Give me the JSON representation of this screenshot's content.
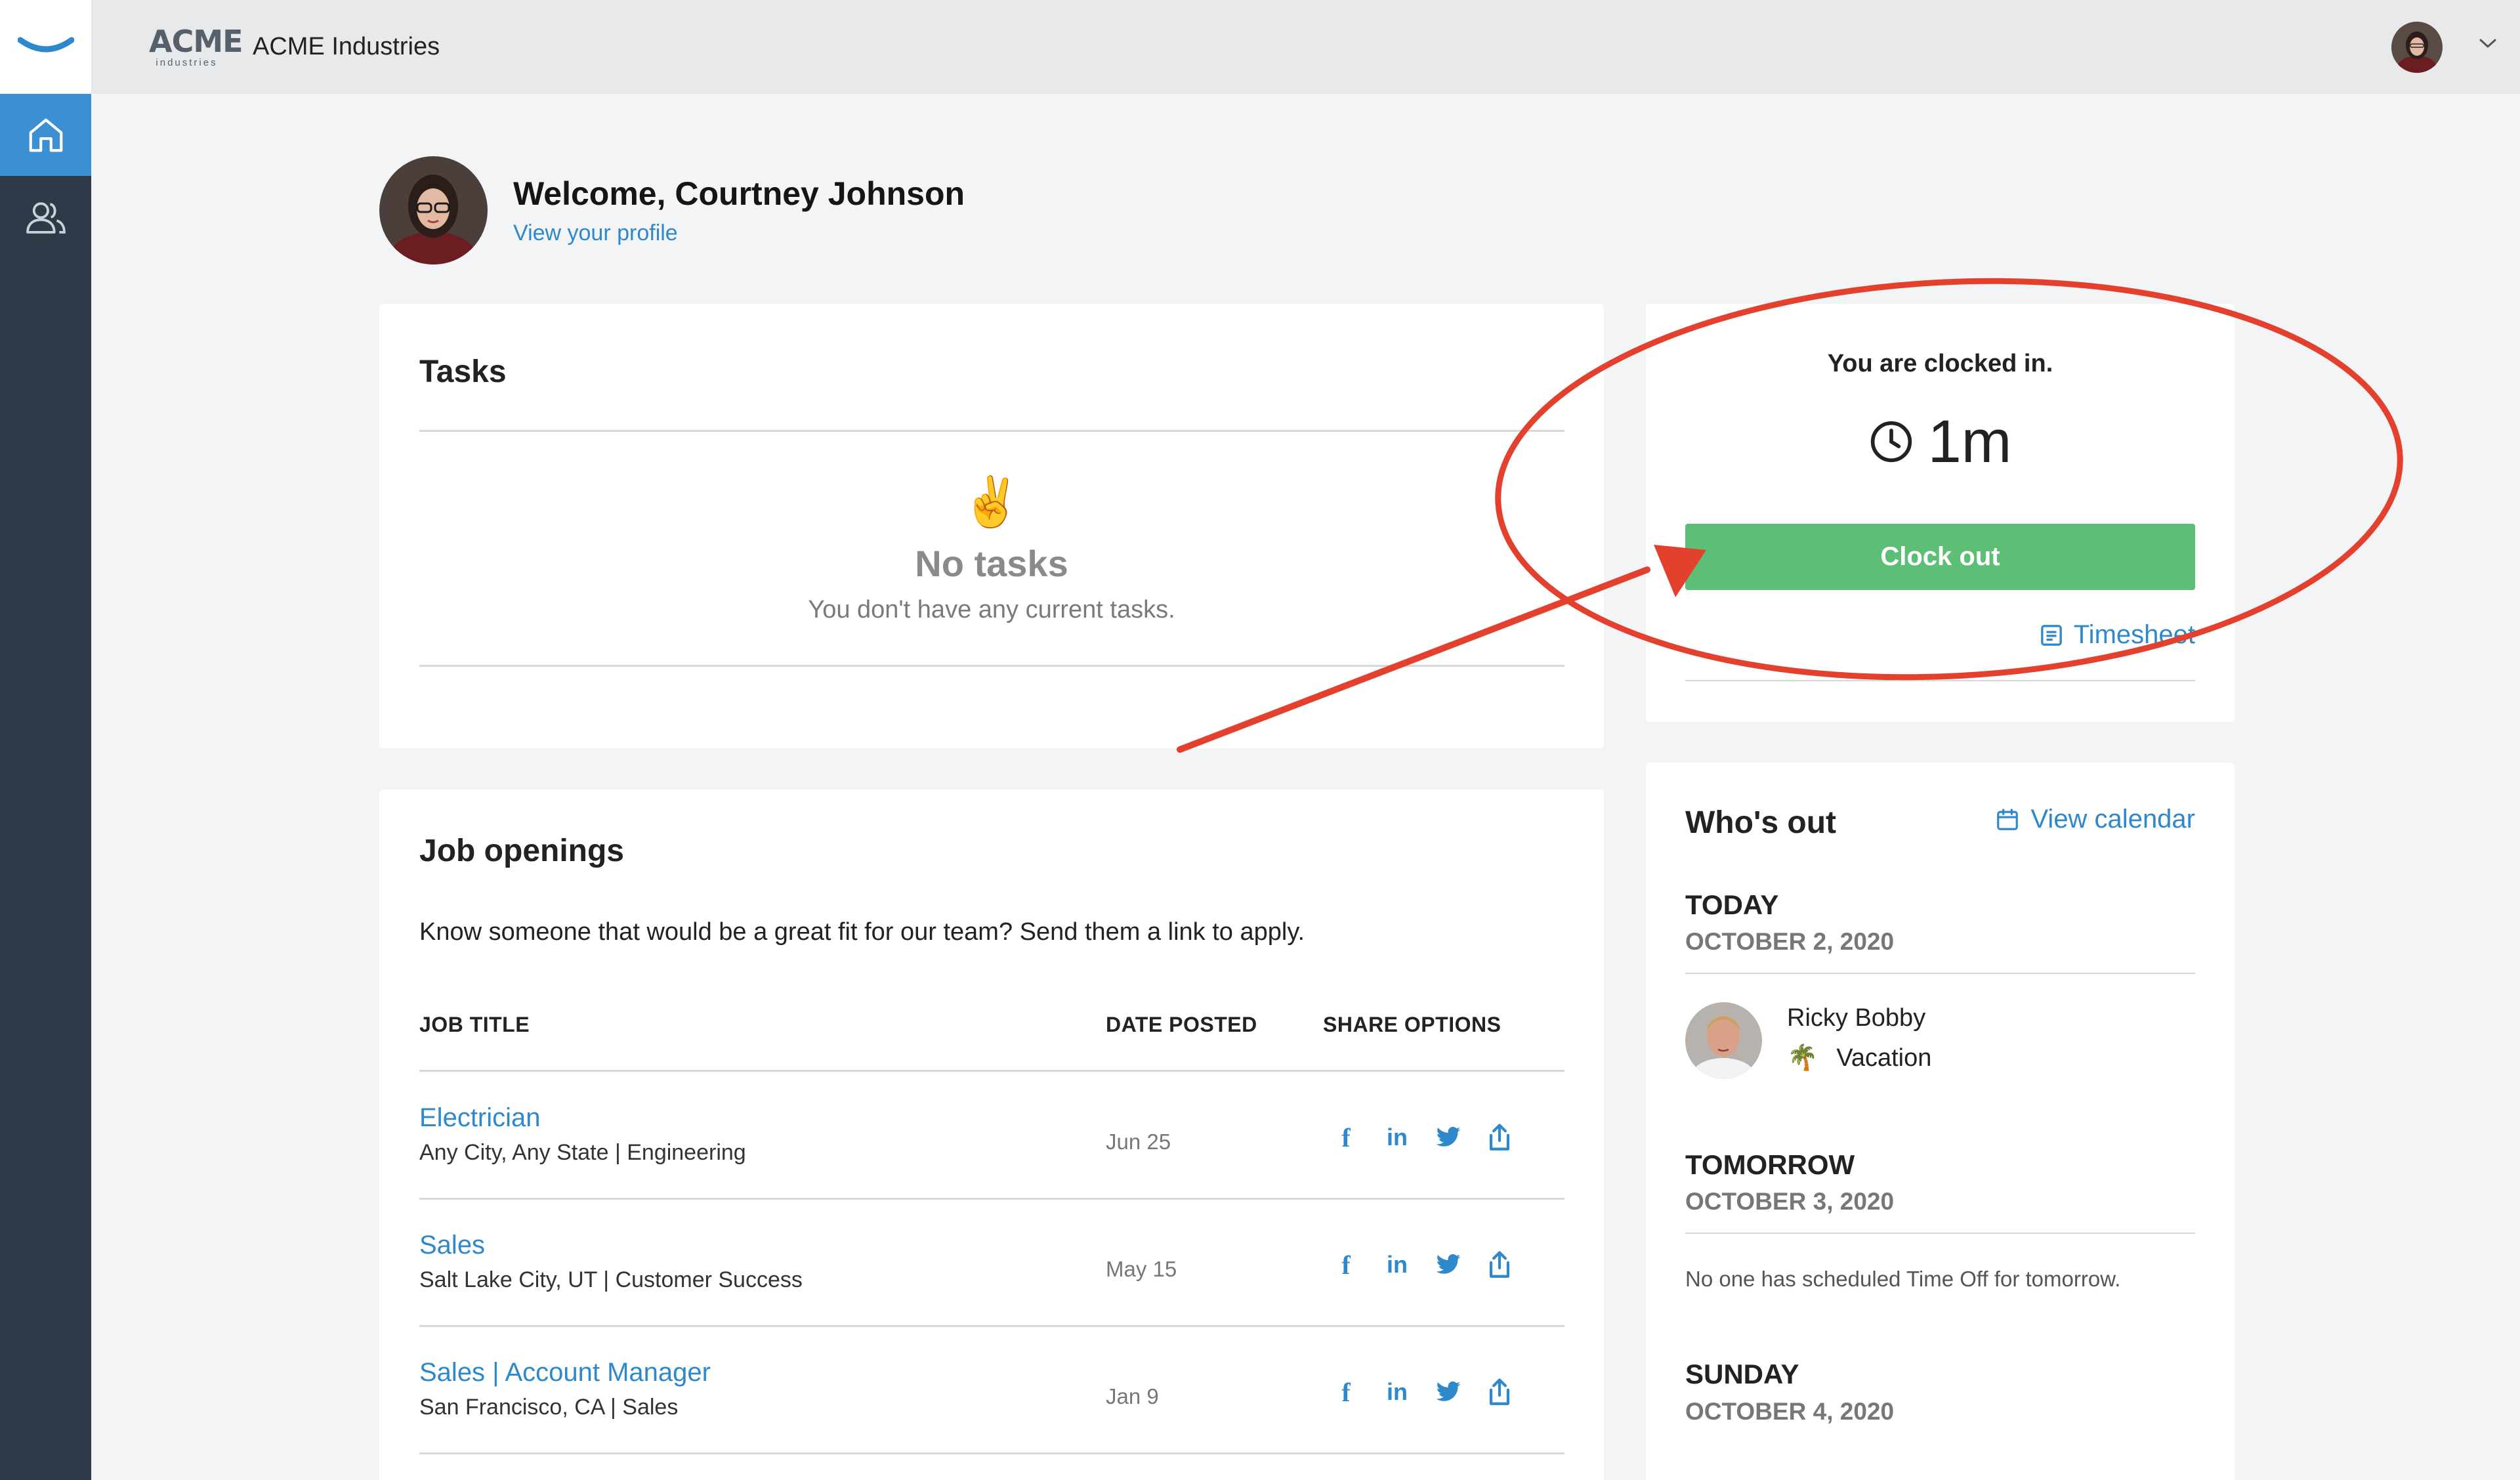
{
  "topbar": {
    "brand_logo_big": "ACME",
    "brand_logo_small": "industries",
    "company_name": "ACME Industries"
  },
  "sidebar": {
    "items": [
      {
        "icon": "home-icon"
      },
      {
        "icon": "people-icon"
      }
    ]
  },
  "welcome": {
    "title": "Welcome, Courtney Johnson",
    "profile_link": "View your profile"
  },
  "tasks": {
    "title": "Tasks",
    "empty_emoji": "✌️",
    "empty_title": "No tasks",
    "empty_subtitle": "You don't have any current tasks."
  },
  "clock": {
    "status": "You are clocked in.",
    "elapsed": "1m",
    "clock_out_label": "Clock out",
    "timesheet_label": "Timesheet"
  },
  "jobs": {
    "title": "Job openings",
    "intro": "Know someone that would be a great fit for our team? Send them a link to apply.",
    "columns": [
      "JOB TITLE",
      "DATE POSTED",
      "SHARE OPTIONS"
    ],
    "rows": [
      {
        "title": "Electrician",
        "subtitle": "Any City, Any State | Engineering",
        "date": "Jun 25"
      },
      {
        "title": "Sales",
        "subtitle": "Salt Lake City, UT | Customer Success",
        "date": "May 15"
      },
      {
        "title": "Sales | Account Manager",
        "subtitle": "San Francisco, CA | Sales",
        "date": "Jan 9"
      }
    ],
    "share_icons": [
      "facebook-icon",
      "linkedin-icon",
      "twitter-icon",
      "share-icon"
    ]
  },
  "whos_out": {
    "title": "Who's out",
    "view_calendar": "View calendar",
    "days": [
      {
        "label": "TODAY",
        "date": "OCTOBER 2, 2020",
        "person": "Ricky Bobby",
        "reason": "Vacation",
        "reason_emoji": "🌴"
      },
      {
        "label": "TOMORROW",
        "date": "OCTOBER 3, 2020",
        "empty": "No one has scheduled Time Off for tomorrow."
      },
      {
        "label": "SUNDAY",
        "date": "OCTOBER 4, 2020"
      }
    ]
  },
  "colors": {
    "accent": "#2e88cc",
    "sidebar": "#2d3a47",
    "active_nav": "#3b8fd3",
    "clock_out_button": "#5dbf75",
    "annotation": "#e3402d"
  }
}
